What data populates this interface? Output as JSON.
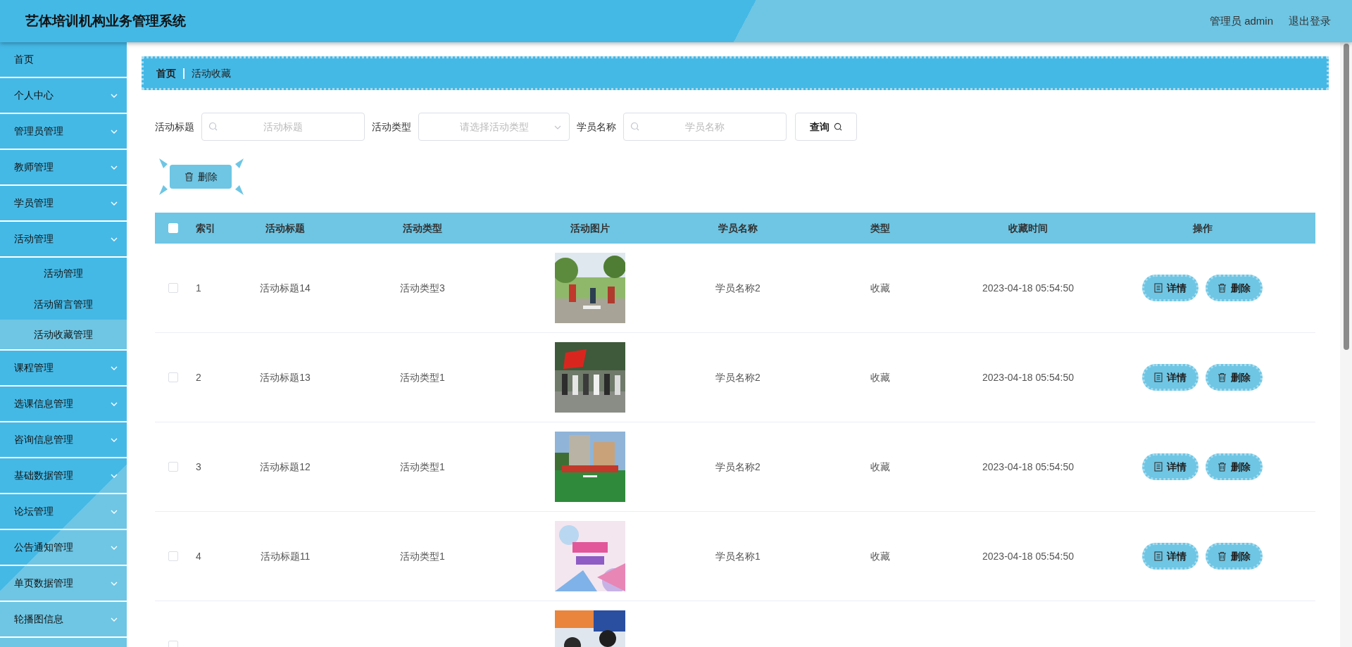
{
  "header": {
    "title": "艺体培训机构业务管理系统",
    "user": "管理员 admin",
    "logout": "退出登录"
  },
  "sidebar": {
    "items": [
      {
        "label": "首页",
        "kind": "link"
      },
      {
        "label": "个人中心",
        "kind": "menu"
      },
      {
        "label": "管理员管理",
        "kind": "menu"
      },
      {
        "label": "教师管理",
        "kind": "menu"
      },
      {
        "label": "学员管理",
        "kind": "menu"
      },
      {
        "label": "活动管理",
        "kind": "menu",
        "children": [
          {
            "label": "活动管理",
            "selected": false
          },
          {
            "label": "活动留言管理",
            "selected": false
          },
          {
            "label": "活动收藏管理",
            "selected": true
          }
        ]
      },
      {
        "label": "课程管理",
        "kind": "menu"
      },
      {
        "label": "选课信息管理",
        "kind": "menu"
      },
      {
        "label": "咨询信息管理",
        "kind": "menu"
      },
      {
        "label": "基础数据管理",
        "kind": "menu"
      },
      {
        "label": "论坛管理",
        "kind": "menu"
      },
      {
        "label": "公告通知管理",
        "kind": "menu"
      },
      {
        "label": "单页数据管理",
        "kind": "menu"
      },
      {
        "label": "轮播图信息",
        "kind": "menu"
      }
    ]
  },
  "breadcrumb": [
    "首页",
    "活动收藏"
  ],
  "filters": [
    {
      "kind": "search",
      "label": "活动标题",
      "placeholder": "活动标题"
    },
    {
      "kind": "select",
      "label": "活动类型",
      "placeholder": "请选择活动类型"
    },
    {
      "kind": "search",
      "label": "学员名称",
      "placeholder": "学员名称"
    }
  ],
  "query_button": "查询",
  "delete_button": "删除",
  "table": {
    "all_checked": false,
    "columns": [
      "索引",
      "活动标题",
      "活动类型",
      "活动图片",
      "学员名称",
      "类型",
      "收藏时间",
      "操作"
    ],
    "rows": [
      {
        "checked": false,
        "index": "1",
        "title": "活动标题14",
        "type": "活动类型3",
        "picture": {
          "kind": "picture"
        },
        "student": "学员名称2",
        "kind": "收藏",
        "time": "2023-04-18 05:54:50",
        "actions": [
          "详情",
          "删除"
        ]
      },
      {
        "checked": false,
        "index": "2",
        "title": "活动标题13",
        "type": "活动类型1",
        "picture": {
          "kind": "picture"
        },
        "student": "学员名称2",
        "kind": "收藏",
        "time": "2023-04-18 05:54:50",
        "actions": [
          "详情",
          "删除"
        ]
      },
      {
        "checked": false,
        "index": "3",
        "title": "活动标题12",
        "type": "活动类型1",
        "picture": {
          "kind": "picture"
        },
        "student": "学员名称2",
        "kind": "收藏",
        "time": "2023-04-18 05:54:50",
        "actions": [
          "详情",
          "删除"
        ]
      },
      {
        "checked": false,
        "index": "4",
        "title": "活动标题11",
        "type": "活动类型1",
        "picture": {
          "kind": "picture"
        },
        "student": "学员名称1",
        "kind": "收藏",
        "time": "2023-04-18 05:54:50",
        "actions": [
          "详情",
          "删除"
        ]
      },
      {
        "checked": false,
        "picture": {
          "kind": "picture"
        }
      }
    ]
  }
}
